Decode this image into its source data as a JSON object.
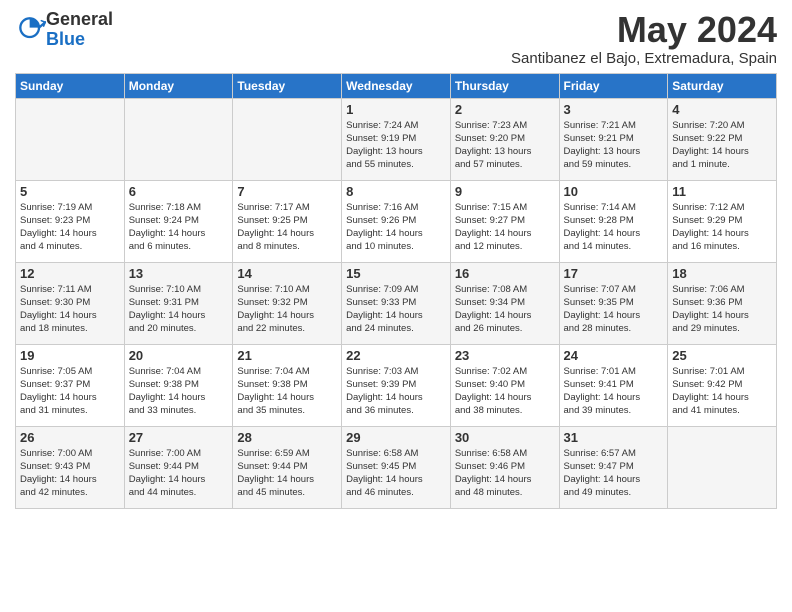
{
  "logo": {
    "general": "General",
    "blue": "Blue"
  },
  "header": {
    "month": "May 2024",
    "location": "Santibanez el Bajo, Extremadura, Spain"
  },
  "weekdays": [
    "Sunday",
    "Monday",
    "Tuesday",
    "Wednesday",
    "Thursday",
    "Friday",
    "Saturday"
  ],
  "weeks": [
    [
      {
        "day": "",
        "info": ""
      },
      {
        "day": "",
        "info": ""
      },
      {
        "day": "",
        "info": ""
      },
      {
        "day": "1",
        "info": "Sunrise: 7:24 AM\nSunset: 9:19 PM\nDaylight: 13 hours\nand 55 minutes."
      },
      {
        "day": "2",
        "info": "Sunrise: 7:23 AM\nSunset: 9:20 PM\nDaylight: 13 hours\nand 57 minutes."
      },
      {
        "day": "3",
        "info": "Sunrise: 7:21 AM\nSunset: 9:21 PM\nDaylight: 13 hours\nand 59 minutes."
      },
      {
        "day": "4",
        "info": "Sunrise: 7:20 AM\nSunset: 9:22 PM\nDaylight: 14 hours\nand 1 minute."
      }
    ],
    [
      {
        "day": "5",
        "info": "Sunrise: 7:19 AM\nSunset: 9:23 PM\nDaylight: 14 hours\nand 4 minutes."
      },
      {
        "day": "6",
        "info": "Sunrise: 7:18 AM\nSunset: 9:24 PM\nDaylight: 14 hours\nand 6 minutes."
      },
      {
        "day": "7",
        "info": "Sunrise: 7:17 AM\nSunset: 9:25 PM\nDaylight: 14 hours\nand 8 minutes."
      },
      {
        "day": "8",
        "info": "Sunrise: 7:16 AM\nSunset: 9:26 PM\nDaylight: 14 hours\nand 10 minutes."
      },
      {
        "day": "9",
        "info": "Sunrise: 7:15 AM\nSunset: 9:27 PM\nDaylight: 14 hours\nand 12 minutes."
      },
      {
        "day": "10",
        "info": "Sunrise: 7:14 AM\nSunset: 9:28 PM\nDaylight: 14 hours\nand 14 minutes."
      },
      {
        "day": "11",
        "info": "Sunrise: 7:12 AM\nSunset: 9:29 PM\nDaylight: 14 hours\nand 16 minutes."
      }
    ],
    [
      {
        "day": "12",
        "info": "Sunrise: 7:11 AM\nSunset: 9:30 PM\nDaylight: 14 hours\nand 18 minutes."
      },
      {
        "day": "13",
        "info": "Sunrise: 7:10 AM\nSunset: 9:31 PM\nDaylight: 14 hours\nand 20 minutes."
      },
      {
        "day": "14",
        "info": "Sunrise: 7:10 AM\nSunset: 9:32 PM\nDaylight: 14 hours\nand 22 minutes."
      },
      {
        "day": "15",
        "info": "Sunrise: 7:09 AM\nSunset: 9:33 PM\nDaylight: 14 hours\nand 24 minutes."
      },
      {
        "day": "16",
        "info": "Sunrise: 7:08 AM\nSunset: 9:34 PM\nDaylight: 14 hours\nand 26 minutes."
      },
      {
        "day": "17",
        "info": "Sunrise: 7:07 AM\nSunset: 9:35 PM\nDaylight: 14 hours\nand 28 minutes."
      },
      {
        "day": "18",
        "info": "Sunrise: 7:06 AM\nSunset: 9:36 PM\nDaylight: 14 hours\nand 29 minutes."
      }
    ],
    [
      {
        "day": "19",
        "info": "Sunrise: 7:05 AM\nSunset: 9:37 PM\nDaylight: 14 hours\nand 31 minutes."
      },
      {
        "day": "20",
        "info": "Sunrise: 7:04 AM\nSunset: 9:38 PM\nDaylight: 14 hours\nand 33 minutes."
      },
      {
        "day": "21",
        "info": "Sunrise: 7:04 AM\nSunset: 9:38 PM\nDaylight: 14 hours\nand 35 minutes."
      },
      {
        "day": "22",
        "info": "Sunrise: 7:03 AM\nSunset: 9:39 PM\nDaylight: 14 hours\nand 36 minutes."
      },
      {
        "day": "23",
        "info": "Sunrise: 7:02 AM\nSunset: 9:40 PM\nDaylight: 14 hours\nand 38 minutes."
      },
      {
        "day": "24",
        "info": "Sunrise: 7:01 AM\nSunset: 9:41 PM\nDaylight: 14 hours\nand 39 minutes."
      },
      {
        "day": "25",
        "info": "Sunrise: 7:01 AM\nSunset: 9:42 PM\nDaylight: 14 hours\nand 41 minutes."
      }
    ],
    [
      {
        "day": "26",
        "info": "Sunrise: 7:00 AM\nSunset: 9:43 PM\nDaylight: 14 hours\nand 42 minutes."
      },
      {
        "day": "27",
        "info": "Sunrise: 7:00 AM\nSunset: 9:44 PM\nDaylight: 14 hours\nand 44 minutes."
      },
      {
        "day": "28",
        "info": "Sunrise: 6:59 AM\nSunset: 9:44 PM\nDaylight: 14 hours\nand 45 minutes."
      },
      {
        "day": "29",
        "info": "Sunrise: 6:58 AM\nSunset: 9:45 PM\nDaylight: 14 hours\nand 46 minutes."
      },
      {
        "day": "30",
        "info": "Sunrise: 6:58 AM\nSunset: 9:46 PM\nDaylight: 14 hours\nand 48 minutes."
      },
      {
        "day": "31",
        "info": "Sunrise: 6:57 AM\nSunset: 9:47 PM\nDaylight: 14 hours\nand 49 minutes."
      },
      {
        "day": "",
        "info": ""
      }
    ]
  ]
}
